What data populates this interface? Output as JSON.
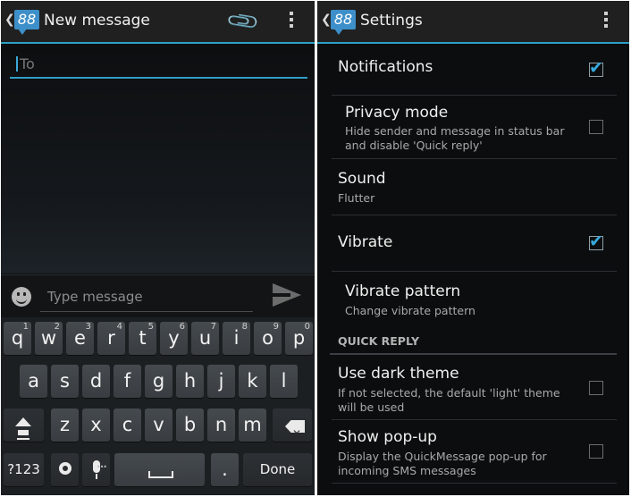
{
  "compose": {
    "title": "New message",
    "to_placeholder": "To",
    "message_placeholder": "Type message",
    "icons": {
      "back": "chevron-left-icon",
      "logo": "app-logo-icon",
      "attach": "paperclip-icon",
      "overflow": "overflow-menu-icon",
      "emoji": "smiley-icon",
      "send": "send-icon"
    }
  },
  "keyboard": {
    "row1": [
      {
        "label": "q",
        "hint": "1"
      },
      {
        "label": "w",
        "hint": "2"
      },
      {
        "label": "e",
        "hint": "3"
      },
      {
        "label": "r",
        "hint": "4"
      },
      {
        "label": "t",
        "hint": "5"
      },
      {
        "label": "y",
        "hint": "6"
      },
      {
        "label": "u",
        "hint": "7"
      },
      {
        "label": "i",
        "hint": "8"
      },
      {
        "label": "o",
        "hint": "9"
      },
      {
        "label": "p",
        "hint": "0"
      }
    ],
    "row2": [
      "a",
      "s",
      "d",
      "f",
      "g",
      "h",
      "j",
      "k",
      "l"
    ],
    "row3": [
      "z",
      "x",
      "c",
      "v",
      "b",
      "n",
      "m"
    ],
    "symbols_label": "?123",
    "period_label": ".",
    "done_label": "Done"
  },
  "settings": {
    "title": "Settings",
    "items": [
      {
        "title": "Notifications",
        "subtitle": "",
        "checkbox": true,
        "checked": true
      },
      {
        "title": "Privacy mode",
        "subtitle": "Hide sender and message in status bar and disable 'Quick reply'",
        "checkbox": true,
        "checked": false
      },
      {
        "title": "Sound",
        "subtitle": "Flutter",
        "checkbox": false,
        "checked": false
      },
      {
        "title": "Vibrate",
        "subtitle": "",
        "checkbox": true,
        "checked": true
      },
      {
        "title": "Vibrate pattern",
        "subtitle": "Change vibrate pattern",
        "checkbox": false,
        "checked": false
      }
    ],
    "section_header": "QUICK REPLY",
    "section_items": [
      {
        "title": "Use dark theme",
        "subtitle": "If not selected, the default 'light' theme will be used",
        "checkbox": true,
        "checked": false
      },
      {
        "title": "Show pop-up",
        "subtitle": "Display the QuickMessage pop-up for incoming SMS messages",
        "checkbox": true,
        "checked": false
      }
    ],
    "accent_color": "#2f9fc6",
    "check_color": "#37a9dd"
  }
}
